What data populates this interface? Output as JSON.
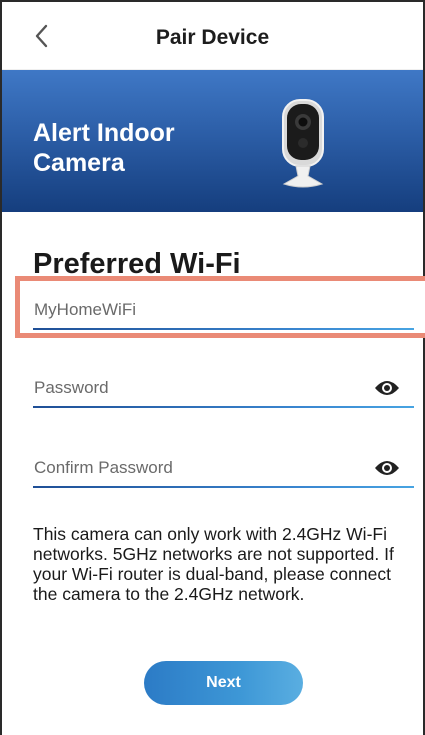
{
  "header": {
    "title": "Pair Device",
    "back_icon": "chevron-left-icon"
  },
  "banner": {
    "product_name": "Alert Indoor Camera",
    "image": "indoor-camera-image"
  },
  "form": {
    "section_title": "Preferred Wi-Fi",
    "ssid_value": "MyHomeWiFi",
    "password_placeholder": "Password",
    "confirm_password_placeholder": "Confirm Password",
    "visibility_icon": "eye-icon"
  },
  "info_text": "This camera can only work with 2.4GHz Wi-Fi networks. 5GHz networks are not supported. If your Wi-Fi router is dual-band, please connect the camera to the 2.4GHz network.",
  "actions": {
    "next_label": "Next"
  },
  "colors": {
    "banner": "#2c5ea7",
    "highlight": "#ea8a76",
    "underline": "#1f4f96",
    "button": "#3d97d6"
  }
}
